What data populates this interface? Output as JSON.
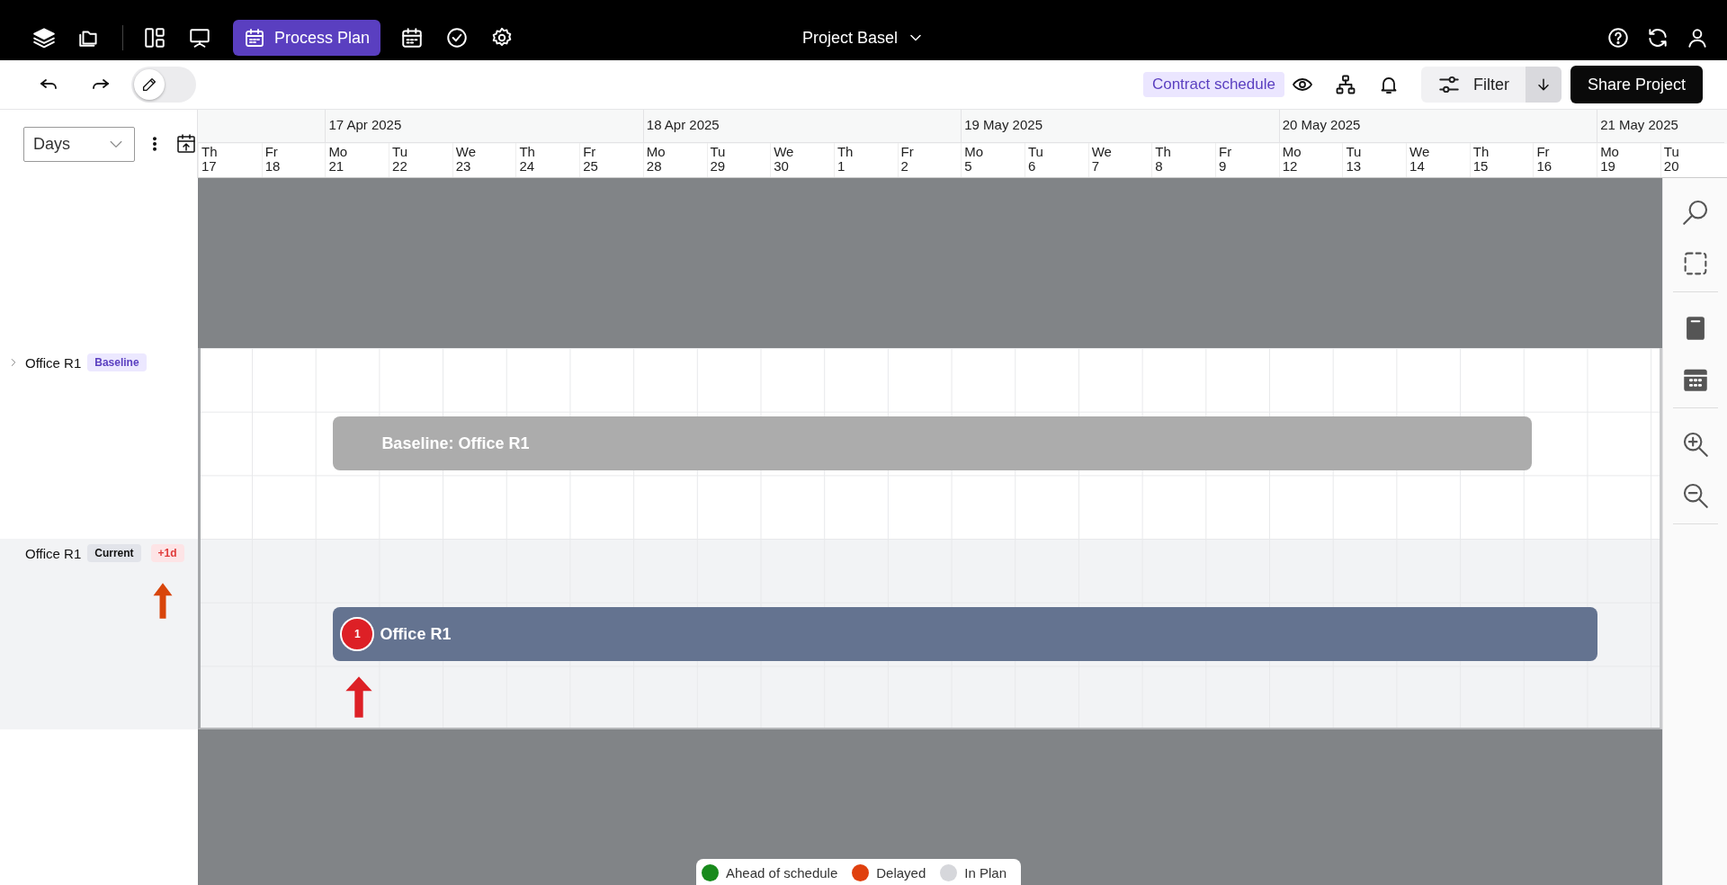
{
  "nav": {
    "items": [
      {
        "selected": false
      },
      {
        "selected": false
      },
      {
        "selected": true,
        "label": "Process Plan"
      },
      {
        "selected": false
      },
      {
        "selected": false
      },
      {
        "selected": false
      }
    ],
    "project": "Project Basel"
  },
  "toolbar": {
    "edit_mode": {
      "on": false
    },
    "schedule_chip": "Contract schedule",
    "filter": "Filter",
    "share": "Share Project"
  },
  "scale": {
    "value": "Days"
  },
  "weeks": [
    {
      "days": [
        {
          "weekday": "Th",
          "date": "17"
        },
        {
          "weekday": "Fr",
          "date": "18"
        }
      ]
    },
    {
      "label": "17 Apr 2025",
      "days": [
        {
          "weekday": "Mo",
          "date": "21"
        },
        {
          "weekday": "Tu",
          "date": "22"
        },
        {
          "weekday": "We",
          "date": "23"
        },
        {
          "weekday": "Th",
          "date": "24"
        },
        {
          "weekday": "Fr",
          "date": "25"
        }
      ]
    },
    {
      "label": "18 Apr 2025",
      "days": [
        {
          "weekday": "Mo",
          "date": "28"
        },
        {
          "weekday": "Tu",
          "date": "29"
        },
        {
          "weekday": "We",
          "date": "30"
        },
        {
          "weekday": "Th",
          "date": "1"
        },
        {
          "weekday": "Fr",
          "date": "2"
        }
      ]
    },
    {
      "label": "19 May 2025",
      "days": [
        {
          "weekday": "Mo",
          "date": "5"
        },
        {
          "weekday": "Tu",
          "date": "6"
        },
        {
          "weekday": "We",
          "date": "7"
        },
        {
          "weekday": "Th",
          "date": "8"
        },
        {
          "weekday": "Fr",
          "date": "9"
        }
      ]
    },
    {
      "label": "20 May 2025",
      "days": [
        {
          "weekday": "Mo",
          "date": "12"
        },
        {
          "weekday": "Tu",
          "date": "13"
        },
        {
          "weekday": "We",
          "date": "14"
        },
        {
          "weekday": "Th",
          "date": "15"
        },
        {
          "weekday": "Fr",
          "date": "16"
        }
      ]
    },
    {
      "label": "21 May 2025",
      "days": [
        {
          "weekday": "Mo",
          "date": "19"
        },
        {
          "weekday": "Tu",
          "date": "20"
        }
      ]
    }
  ],
  "rows": [
    {
      "kind": "baseline",
      "name": "Office R1",
      "expanded": false,
      "tags": [
        {
          "kind": "baseline",
          "text": "Baseline"
        }
      ],
      "bar": {
        "label": "Baseline: Office R1"
      }
    },
    {
      "kind": "current",
      "name": "Office R1",
      "tags": [
        {
          "kind": "current",
          "text": "Current"
        },
        {
          "kind": "delay",
          "text": "+1d"
        }
      ],
      "bar": {
        "label": "Office R1",
        "issue_count": "1"
      }
    }
  ],
  "legend": [
    {
      "label": "Ahead of schedule",
      "color": "#188a1c"
    },
    {
      "label": "Delayed",
      "color": "#e0400e"
    },
    {
      "label": "In Plan",
      "color": "#d6d7db"
    }
  ]
}
